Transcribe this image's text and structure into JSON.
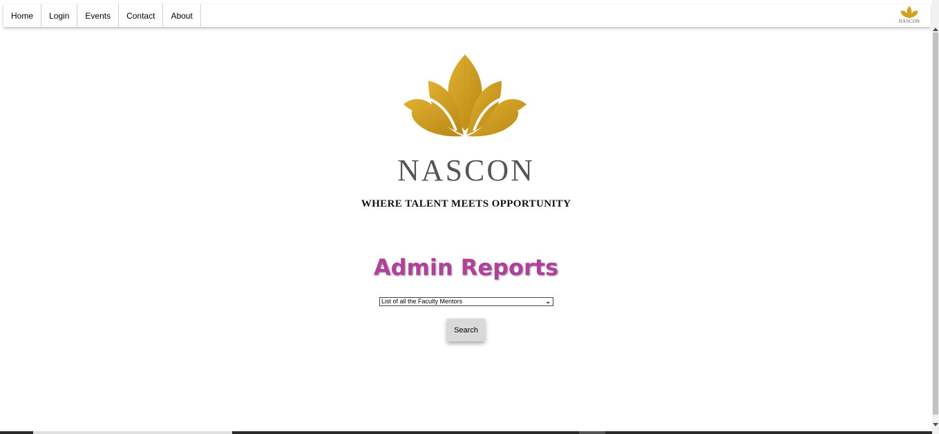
{
  "nav": {
    "items": [
      {
        "label": "Home"
      },
      {
        "label": "Login"
      },
      {
        "label": "Events"
      },
      {
        "label": "Contact"
      },
      {
        "label": "About"
      }
    ],
    "logo_text": "NASCON"
  },
  "brand": {
    "name": "NASCON",
    "tagline": "WHERE TALENT MEETS OPPORTUNITY",
    "logo_color": "#d4a020"
  },
  "main": {
    "title": "Admin Reports",
    "title_color": "#b0409c",
    "report_select": {
      "selected": "List of all the Faculty Mentors"
    },
    "search_label": "Search"
  }
}
